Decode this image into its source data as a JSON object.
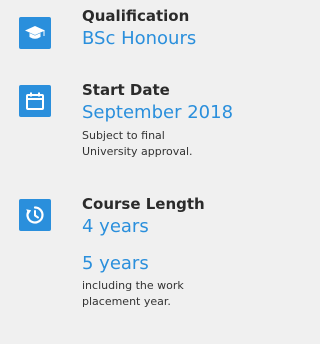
{
  "colors": {
    "accent": "#2a8fdc",
    "background": "#f0f0f0",
    "label_text": "#2b2b2b"
  },
  "facts": [
    {
      "icon": "graduation-cap-icon",
      "label": "Qualification",
      "value": "BSc Honours"
    },
    {
      "icon": "calendar-icon",
      "label": "Start Date",
      "value": "September 2018",
      "note_lines": [
        "Subject to final",
        "University approval."
      ]
    },
    {
      "icon": "clock-icon",
      "label": "Course Length",
      "value": "4 years",
      "alt_value": "5 years",
      "alt_note_lines": [
        "including the work",
        "placement year."
      ]
    }
  ]
}
